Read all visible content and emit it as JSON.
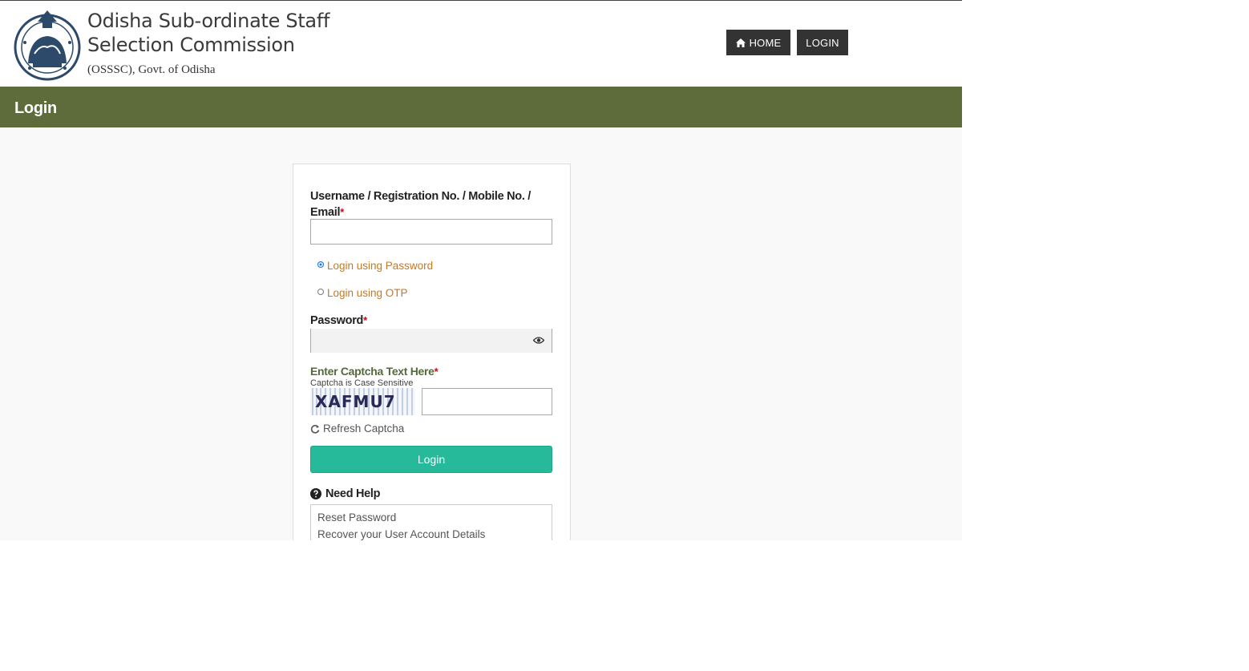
{
  "header": {
    "org_line1": "Odisha Sub-ordinate Staff",
    "org_line2": "Selection Commission",
    "org_sub": "(OSSSC), Govt. of Odisha",
    "nav": {
      "home_label": "HOME",
      "login_label": "LOGIN"
    }
  },
  "banner": {
    "title": "Login"
  },
  "form": {
    "username_label": "Username / Registration No. / Mobile No. / Email",
    "required_mark": "*",
    "username_value": "",
    "radio_password_label": "Login using Password",
    "radio_otp_label": "Login using OTP",
    "selected_mode": "password",
    "password_label": "Password",
    "password_value": "",
    "captcha_title": "Enter Captcha Text Here",
    "captcha_note": "Captcha is Case Sensitive",
    "captcha_text": "XAFMU7",
    "captcha_value": "",
    "refresh_label": "Refresh Captcha",
    "login_button_label": "Login"
  },
  "help": {
    "title": "Need Help",
    "links": [
      "Reset Password",
      "Recover your User Account Details"
    ]
  },
  "colors": {
    "banner": "#5e6b3a",
    "nav_button": "#333333",
    "login_button": "#26b99a",
    "radio_label": "#c87820",
    "captcha_title": "#556a3a",
    "required": "#d0021b"
  },
  "icons": [
    "state-emblem-icon",
    "home-icon",
    "eye-icon",
    "refresh-icon",
    "question-circle-icon"
  ]
}
